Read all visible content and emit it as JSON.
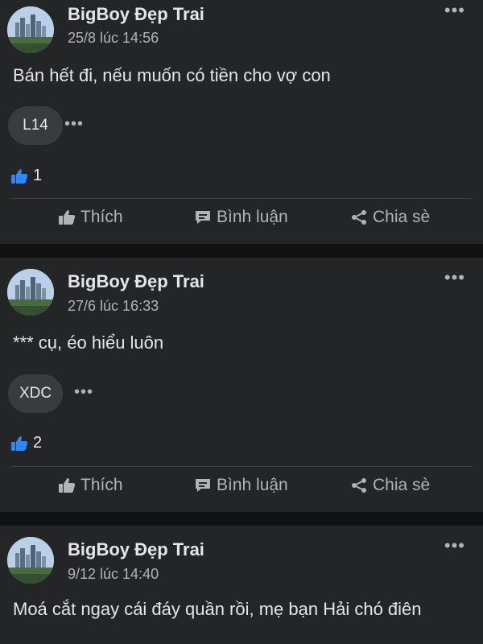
{
  "posts": [
    {
      "author": "BigBoy Đẹp Trai",
      "timestamp": "25/8 lúc 14:56",
      "more": "•••",
      "content": "Bán hết đi, nếu muốn có tiền cho vợ con",
      "chip": "L14",
      "chip_more": "•••",
      "like_count": "1",
      "actions": {
        "like": "Thích",
        "comment": "Bình luận",
        "share": "Chia sè"
      }
    },
    {
      "author": "BigBoy Đẹp Trai",
      "timestamp": "27/6 lúc 16:33",
      "more": "•••",
      "content": "*** cụ, éo hiểu luôn",
      "chip": "XDC",
      "chip_more": "•••",
      "like_count": "2",
      "actions": {
        "like": "Thích",
        "comment": "Bình luận",
        "share": "Chia sè"
      }
    },
    {
      "author": "BigBoy Đẹp Trai",
      "timestamp": "9/12 lúc 14:40",
      "more": "•••",
      "content": "Moá cắt ngay cái đáy quần rồi, mẹ bạn Hải chó điên"
    }
  ],
  "colors": {
    "background": "#111112",
    "card": "#242526",
    "text": "#e4e6eb",
    "secondary_text": "#b0b3b8",
    "chip": "#3a3b3c",
    "like_blue": "#2d88ff"
  },
  "icons": {
    "avatar": "city-skyline-avatar",
    "like_summary": "thumbs-up-icon",
    "like_action": "thumbs-up-outline-icon",
    "comment_action": "speech-bubble-icon",
    "share_action": "share-icon"
  }
}
